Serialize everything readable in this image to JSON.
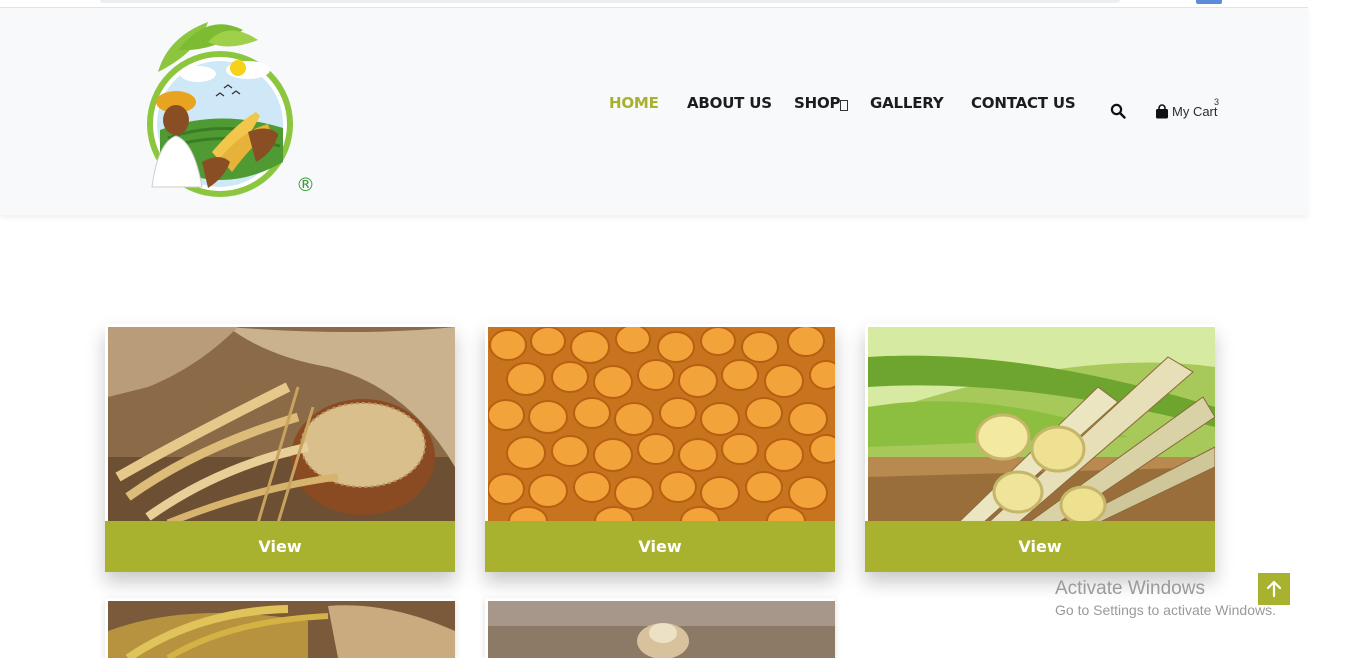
{
  "brand": {
    "registered_mark": "®"
  },
  "nav": {
    "items": [
      {
        "label": "HOME",
        "active": true
      },
      {
        "label": "ABOUT US",
        "active": false
      },
      {
        "label": "SHOP",
        "active": false
      },
      {
        "label": "GALLERY",
        "active": false
      },
      {
        "label": "CONTACT US",
        "active": false
      }
    ]
  },
  "actions": {
    "search_icon": "search-icon",
    "cart_icon": "shopping-bag-icon",
    "cart_label": "My Cart",
    "cart_count": "3"
  },
  "products": [
    {
      "image": "wheat",
      "button_label": "View"
    },
    {
      "image": "corn-kernels",
      "button_label": "View"
    },
    {
      "image": "sugarcane",
      "button_label": "View"
    },
    {
      "image": "rice-stalks",
      "button_label": ""
    },
    {
      "image": "grain-bowl",
      "button_label": ""
    }
  ],
  "watermark": {
    "title": "Activate Windows",
    "subtitle": "Go to Settings to activate Windows."
  },
  "scroll_top_icon": "arrow-up-icon",
  "colors": {
    "accent": "#a9b22e",
    "header_bg": "#f8f9fb"
  }
}
